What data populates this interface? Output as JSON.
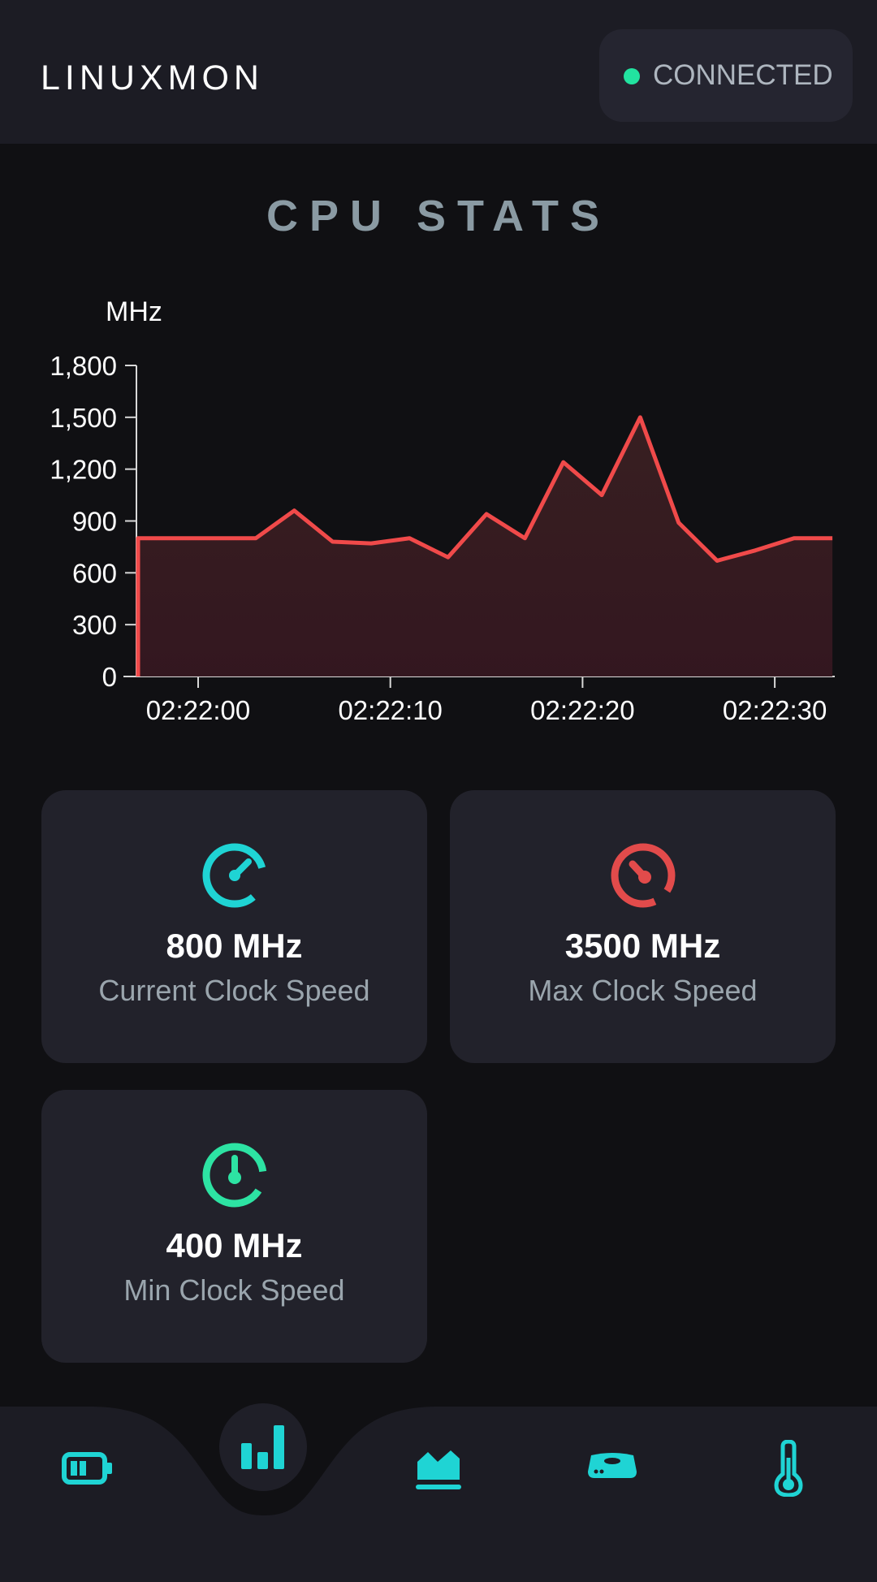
{
  "header": {
    "app_title": "LINUXMON",
    "status": {
      "label": "CONNECTED",
      "color": "#22e3a0"
    }
  },
  "page": {
    "title": "CPU STATS"
  },
  "chart_data": {
    "type": "area",
    "title": "",
    "xlabel": "",
    "ylabel": "MHz",
    "ylim": [
      0,
      1800
    ],
    "y_ticks": [
      "0",
      "300",
      "600",
      "900",
      "1,200",
      "1,500",
      "1,800"
    ],
    "x_ticks": [
      "02:22:00",
      "02:22:10",
      "02:22:20",
      "02:22:30"
    ],
    "grid": false,
    "line_color": "#f04a4a",
    "x": [
      "02:21:57",
      "02:21:57",
      "02:21:59",
      "02:22:01",
      "02:22:03",
      "02:22:05",
      "02:22:07",
      "02:22:09",
      "02:22:11",
      "02:22:13",
      "02:22:15",
      "02:22:17",
      "02:22:19",
      "02:22:21",
      "02:22:23",
      "02:22:25",
      "02:22:27",
      "02:22:29",
      "02:22:31",
      "02:22:33"
    ],
    "series": [
      {
        "values": [
          0,
          800,
          800,
          800,
          800,
          960,
          780,
          770,
          800,
          690,
          940,
          800,
          1240,
          1050,
          1500,
          890,
          670,
          730,
          800,
          800
        ]
      }
    ]
  },
  "cards": [
    {
      "value": "800 MHz",
      "label": "Current Clock Speed",
      "icon": "speedometer-icon",
      "color": "#1fd4d4"
    },
    {
      "value": "3500 MHz",
      "label": "Max Clock Speed",
      "icon": "speedometer-max-icon",
      "color": "#e24b4b"
    },
    {
      "value": "400 MHz",
      "label": "Min Clock Speed",
      "icon": "speedometer-min-icon",
      "color": "#2de3a3"
    }
  ],
  "nav": {
    "items": [
      "battery-icon",
      "bar-chart-icon",
      "area-chart-icon",
      "disk-drive-icon",
      "thermometer-icon"
    ],
    "active": "bar-chart-icon",
    "color": "#1fd4d4"
  }
}
